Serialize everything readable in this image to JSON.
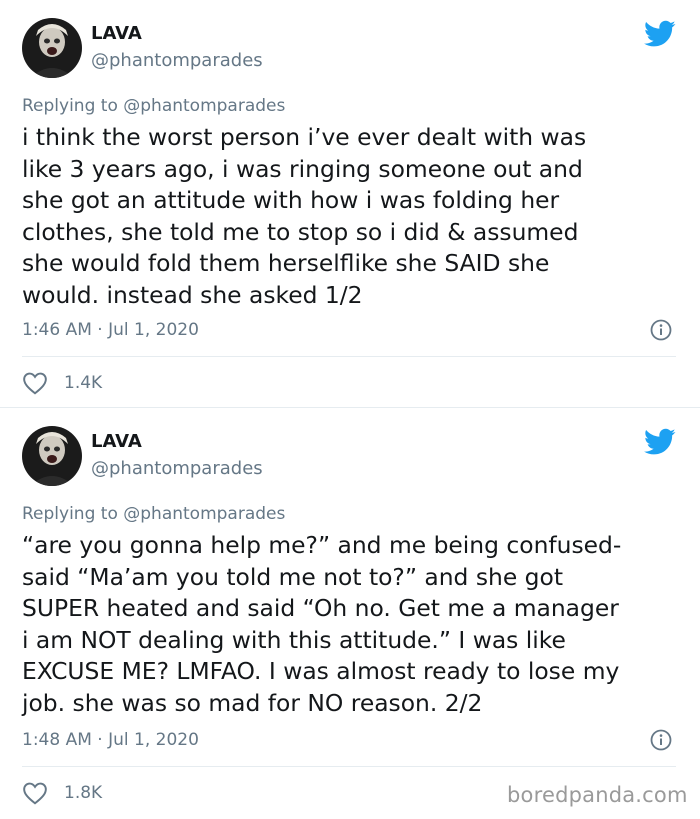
{
  "tweets": [
    {
      "name": "LAVA",
      "handle": "@phantomparades",
      "replying_label": "Replying to",
      "replying_to": "@phantomparades",
      "body": "i think the worst person i’ve ever dealt with was\nlike 3 years ago, i was ringing someone out and\nshe got an attitude with how i was folding her\nclothes, she told me to stop so i did & assumed\nshe would fold them herselflike she SAID she\nwould. instead she asked 1/2",
      "timestamp": "1:46 AM · Jul 1, 2020",
      "likes": "1.4K"
    },
    {
      "name": "LAVA",
      "handle": "@phantomparades",
      "replying_label": "Replying to",
      "replying_to": "@phantomparades",
      "body": "“are you gonna help me?” and me being confused-\nsaid “Ma’am you told me not to?” and she got\nSUPER heated and said “Oh no. Get me a manager\ni am NOT dealing with this attitude.” I was like\nEXCUSE ME? LMFAO. I was almost ready to lose my\njob. she was so mad for NO reason. 2/2",
      "timestamp": "1:48 AM · Jul 1, 2020",
      "likes": "1.8K"
    }
  ],
  "icons": {
    "brand": "twitter-bird-icon",
    "info": "info-icon",
    "like": "heart-icon"
  },
  "colors": {
    "twitter_blue": "#1da1f2",
    "muted": "#657786",
    "text": "#14171a",
    "divider": "#e6ecf0"
  },
  "watermark": "boredpanda.com"
}
